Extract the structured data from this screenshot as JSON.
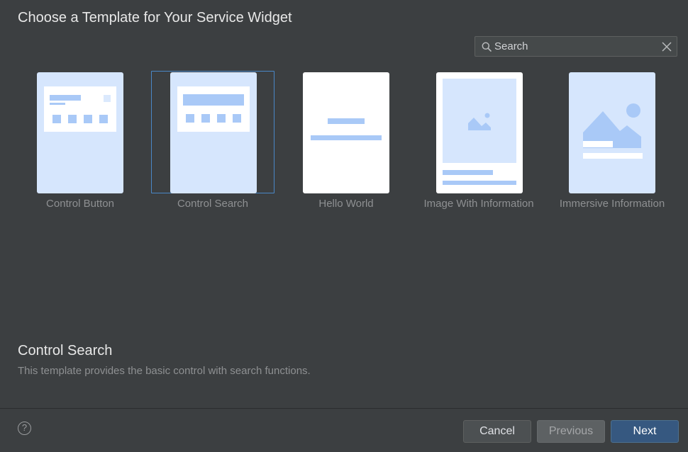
{
  "dialog": {
    "title": "Choose a Template for Your Service Widget"
  },
  "search": {
    "placeholder": "Search",
    "value": ""
  },
  "templates": [
    {
      "label": "Control Button",
      "selected": false
    },
    {
      "label": "Control Search",
      "selected": true
    },
    {
      "label": "Hello World",
      "selected": false
    },
    {
      "label": "Image With Information",
      "selected": false
    },
    {
      "label": "Immersive Information",
      "selected": false
    }
  ],
  "description": {
    "title": "Control Search",
    "text": "This template provides the basic control with search functions."
  },
  "footer": {
    "help_icon": "?",
    "cancel": "Cancel",
    "previous": "Previous",
    "next": "Next"
  },
  "colors": {
    "background": "#3c3f41",
    "card_blue": "#d6e6fd",
    "card_accent": "#a9c9f7",
    "selection_border": "#4a88c7",
    "primary_button": "#365880"
  }
}
